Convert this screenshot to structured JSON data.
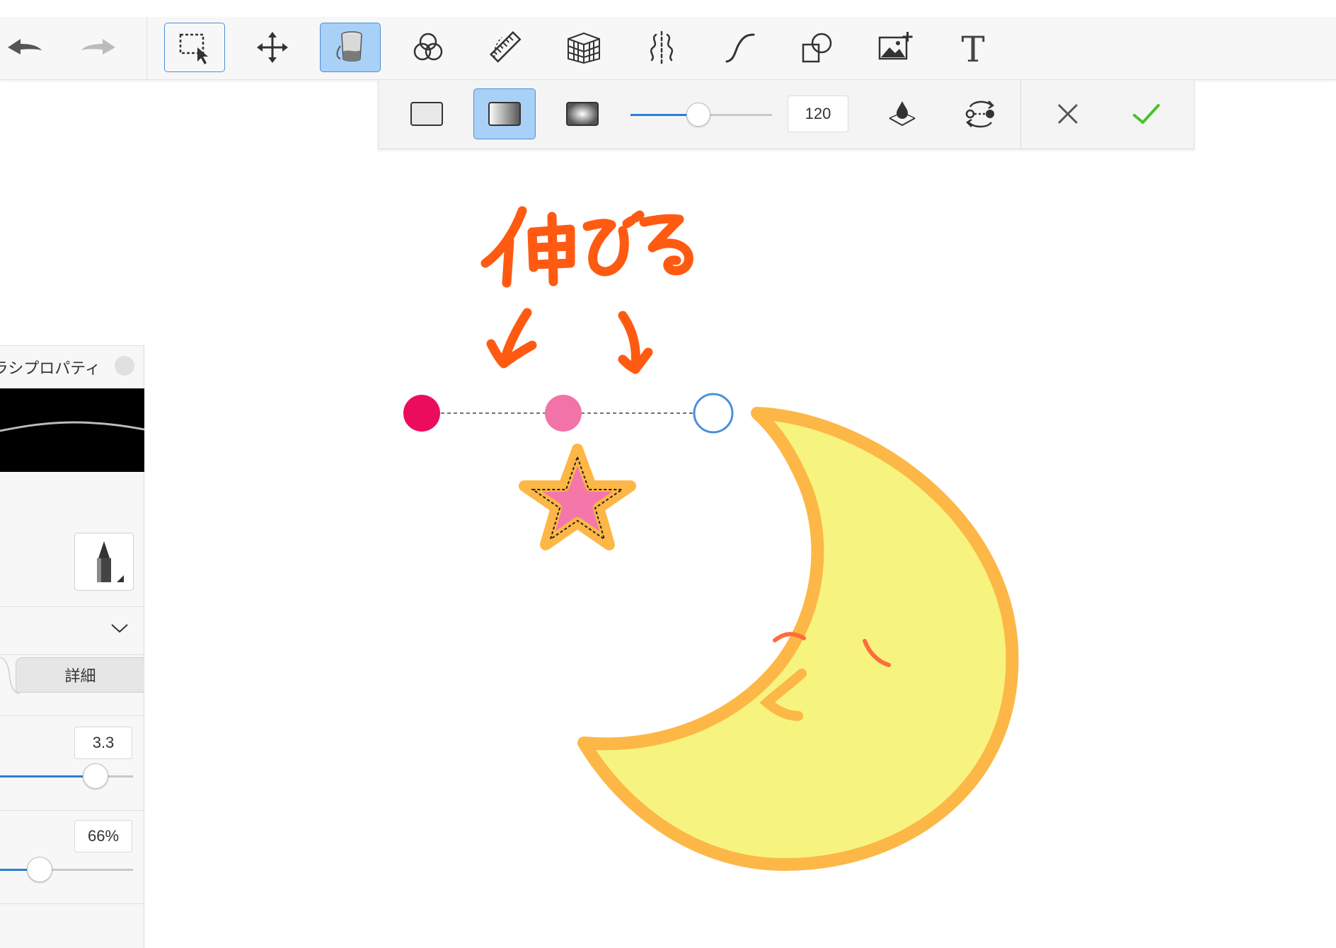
{
  "toolbar": {
    "tools": [
      {
        "name": "undo-icon"
      },
      {
        "name": "redo-icon"
      },
      {
        "name": "selection-tool-icon",
        "state": "selected"
      },
      {
        "name": "transform-move-icon"
      },
      {
        "name": "fill-bucket-icon",
        "state": "active"
      },
      {
        "name": "blend-circles-icon"
      },
      {
        "name": "ruler-icon"
      },
      {
        "name": "perspective-grid-icon"
      },
      {
        "name": "symmetry-icon"
      },
      {
        "name": "curve-stroke-icon"
      },
      {
        "name": "shapes-icon"
      },
      {
        "name": "insert-image-icon"
      },
      {
        "name": "text-tool-icon",
        "glyph": "T"
      }
    ]
  },
  "gradient_bar": {
    "fill_types": [
      {
        "name": "solid-fill-icon"
      },
      {
        "name": "linear-gradient-icon",
        "state": "active"
      },
      {
        "name": "radial-gradient-icon"
      }
    ],
    "slider_value": 120,
    "slider_percent": 0.48,
    "value_text": "120",
    "cancel_icon": "close-icon",
    "confirm_icon": "checkmark-icon",
    "colors": {
      "accent": "#2a7fd6",
      "confirm": "#4cc12a"
    }
  },
  "canvas": {
    "annotation_text": "伸びる",
    "gradient_handles": {
      "start_color": "#ec0c5e",
      "mid_color": "#f273a8",
      "end_outline": "#4a90d9"
    },
    "colors": {
      "moon_fill": "#f6f47f",
      "moon_outline": "#fdb746",
      "star_fill": "#f477aa",
      "annotation": "#ff5a12"
    }
  },
  "panel": {
    "title": "ブラシプロパティ",
    "tab_detail": "詳細",
    "size_value": "3.3",
    "size_percent": 0.72,
    "opacity_value": "66%",
    "opacity_percent": 0.3
  }
}
